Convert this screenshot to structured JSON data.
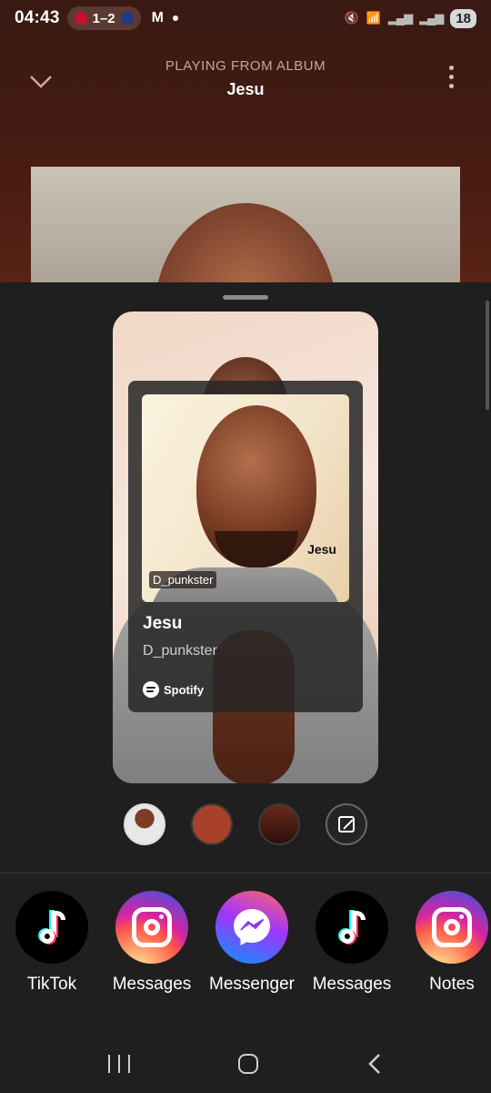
{
  "status_bar": {
    "time": "04:43",
    "score": "1–2",
    "mail_icon": "M",
    "battery": "18"
  },
  "player": {
    "context_label": "PLAYING FROM ALBUM",
    "context_name": "Jesu"
  },
  "share_card": {
    "cover_title": "Jesu",
    "cover_artist": "D_punkster",
    "track_title": "Jesu",
    "track_artist": "D_punkster",
    "brand": "Spotify"
  },
  "background_options": [
    {
      "name": "photo",
      "color": "#7a3d25"
    },
    {
      "name": "rust",
      "color": "#a8402a"
    },
    {
      "name": "dark-gradient",
      "color": "#4a1c13"
    },
    {
      "name": "edit",
      "icon": "edit-icon"
    }
  ],
  "share_targets": [
    {
      "label": "TikTok",
      "icon": "tiktok-icon"
    },
    {
      "label": "Messages",
      "icon": "instagram-icon"
    },
    {
      "label": "Messenger",
      "icon": "messenger-icon"
    },
    {
      "label": "Messages",
      "icon": "tiktok-icon"
    },
    {
      "label": "Notes",
      "icon": "instagram-icon"
    }
  ],
  "colors": {
    "header_bg": "#3b1a12",
    "sheet_bg": "#1f1f1f",
    "accent_rust": "#a8402a"
  }
}
